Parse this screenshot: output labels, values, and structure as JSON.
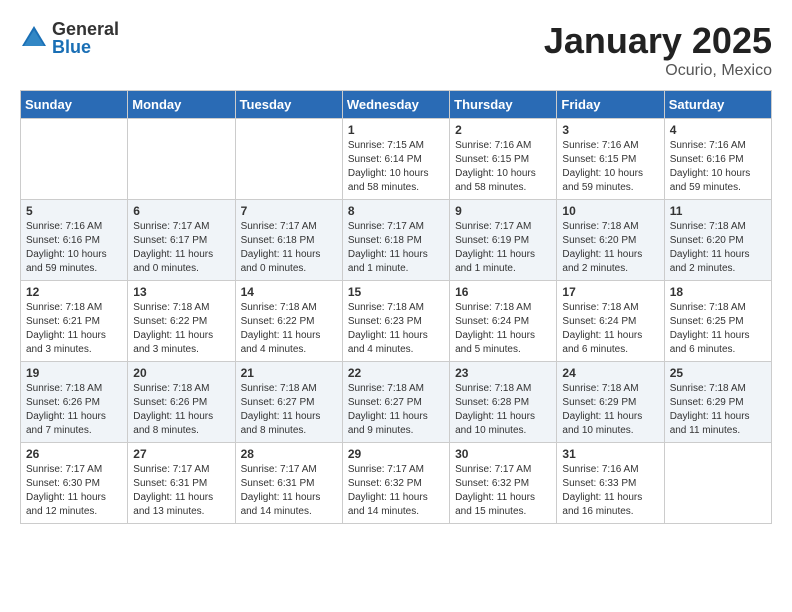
{
  "logo": {
    "general": "General",
    "blue": "Blue"
  },
  "title": "January 2025",
  "location": "Ocurio, Mexico",
  "weekdays": [
    "Sunday",
    "Monday",
    "Tuesday",
    "Wednesday",
    "Thursday",
    "Friday",
    "Saturday"
  ],
  "weeks": [
    [
      {
        "day": "",
        "sunrise": "",
        "sunset": "",
        "daylight": ""
      },
      {
        "day": "",
        "sunrise": "",
        "sunset": "",
        "daylight": ""
      },
      {
        "day": "",
        "sunrise": "",
        "sunset": "",
        "daylight": ""
      },
      {
        "day": "1",
        "sunrise": "Sunrise: 7:15 AM",
        "sunset": "Sunset: 6:14 PM",
        "daylight": "Daylight: 10 hours and 58 minutes."
      },
      {
        "day": "2",
        "sunrise": "Sunrise: 7:16 AM",
        "sunset": "Sunset: 6:15 PM",
        "daylight": "Daylight: 10 hours and 58 minutes."
      },
      {
        "day": "3",
        "sunrise": "Sunrise: 7:16 AM",
        "sunset": "Sunset: 6:15 PM",
        "daylight": "Daylight: 10 hours and 59 minutes."
      },
      {
        "day": "4",
        "sunrise": "Sunrise: 7:16 AM",
        "sunset": "Sunset: 6:16 PM",
        "daylight": "Daylight: 10 hours and 59 minutes."
      }
    ],
    [
      {
        "day": "5",
        "sunrise": "Sunrise: 7:16 AM",
        "sunset": "Sunset: 6:16 PM",
        "daylight": "Daylight: 10 hours and 59 minutes."
      },
      {
        "day": "6",
        "sunrise": "Sunrise: 7:17 AM",
        "sunset": "Sunset: 6:17 PM",
        "daylight": "Daylight: 11 hours and 0 minutes."
      },
      {
        "day": "7",
        "sunrise": "Sunrise: 7:17 AM",
        "sunset": "Sunset: 6:18 PM",
        "daylight": "Daylight: 11 hours and 0 minutes."
      },
      {
        "day": "8",
        "sunrise": "Sunrise: 7:17 AM",
        "sunset": "Sunset: 6:18 PM",
        "daylight": "Daylight: 11 hours and 1 minute."
      },
      {
        "day": "9",
        "sunrise": "Sunrise: 7:17 AM",
        "sunset": "Sunset: 6:19 PM",
        "daylight": "Daylight: 11 hours and 1 minute."
      },
      {
        "day": "10",
        "sunrise": "Sunrise: 7:18 AM",
        "sunset": "Sunset: 6:20 PM",
        "daylight": "Daylight: 11 hours and 2 minutes."
      },
      {
        "day": "11",
        "sunrise": "Sunrise: 7:18 AM",
        "sunset": "Sunset: 6:20 PM",
        "daylight": "Daylight: 11 hours and 2 minutes."
      }
    ],
    [
      {
        "day": "12",
        "sunrise": "Sunrise: 7:18 AM",
        "sunset": "Sunset: 6:21 PM",
        "daylight": "Daylight: 11 hours and 3 minutes."
      },
      {
        "day": "13",
        "sunrise": "Sunrise: 7:18 AM",
        "sunset": "Sunset: 6:22 PM",
        "daylight": "Daylight: 11 hours and 3 minutes."
      },
      {
        "day": "14",
        "sunrise": "Sunrise: 7:18 AM",
        "sunset": "Sunset: 6:22 PM",
        "daylight": "Daylight: 11 hours and 4 minutes."
      },
      {
        "day": "15",
        "sunrise": "Sunrise: 7:18 AM",
        "sunset": "Sunset: 6:23 PM",
        "daylight": "Daylight: 11 hours and 4 minutes."
      },
      {
        "day": "16",
        "sunrise": "Sunrise: 7:18 AM",
        "sunset": "Sunset: 6:24 PM",
        "daylight": "Daylight: 11 hours and 5 minutes."
      },
      {
        "day": "17",
        "sunrise": "Sunrise: 7:18 AM",
        "sunset": "Sunset: 6:24 PM",
        "daylight": "Daylight: 11 hours and 6 minutes."
      },
      {
        "day": "18",
        "sunrise": "Sunrise: 7:18 AM",
        "sunset": "Sunset: 6:25 PM",
        "daylight": "Daylight: 11 hours and 6 minutes."
      }
    ],
    [
      {
        "day": "19",
        "sunrise": "Sunrise: 7:18 AM",
        "sunset": "Sunset: 6:26 PM",
        "daylight": "Daylight: 11 hours and 7 minutes."
      },
      {
        "day": "20",
        "sunrise": "Sunrise: 7:18 AM",
        "sunset": "Sunset: 6:26 PM",
        "daylight": "Daylight: 11 hours and 8 minutes."
      },
      {
        "day": "21",
        "sunrise": "Sunrise: 7:18 AM",
        "sunset": "Sunset: 6:27 PM",
        "daylight": "Daylight: 11 hours and 8 minutes."
      },
      {
        "day": "22",
        "sunrise": "Sunrise: 7:18 AM",
        "sunset": "Sunset: 6:27 PM",
        "daylight": "Daylight: 11 hours and 9 minutes."
      },
      {
        "day": "23",
        "sunrise": "Sunrise: 7:18 AM",
        "sunset": "Sunset: 6:28 PM",
        "daylight": "Daylight: 11 hours and 10 minutes."
      },
      {
        "day": "24",
        "sunrise": "Sunrise: 7:18 AM",
        "sunset": "Sunset: 6:29 PM",
        "daylight": "Daylight: 11 hours and 10 minutes."
      },
      {
        "day": "25",
        "sunrise": "Sunrise: 7:18 AM",
        "sunset": "Sunset: 6:29 PM",
        "daylight": "Daylight: 11 hours and 11 minutes."
      }
    ],
    [
      {
        "day": "26",
        "sunrise": "Sunrise: 7:17 AM",
        "sunset": "Sunset: 6:30 PM",
        "daylight": "Daylight: 11 hours and 12 minutes."
      },
      {
        "day": "27",
        "sunrise": "Sunrise: 7:17 AM",
        "sunset": "Sunset: 6:31 PM",
        "daylight": "Daylight: 11 hours and 13 minutes."
      },
      {
        "day": "28",
        "sunrise": "Sunrise: 7:17 AM",
        "sunset": "Sunset: 6:31 PM",
        "daylight": "Daylight: 11 hours and 14 minutes."
      },
      {
        "day": "29",
        "sunrise": "Sunrise: 7:17 AM",
        "sunset": "Sunset: 6:32 PM",
        "daylight": "Daylight: 11 hours and 14 minutes."
      },
      {
        "day": "30",
        "sunrise": "Sunrise: 7:17 AM",
        "sunset": "Sunset: 6:32 PM",
        "daylight": "Daylight: 11 hours and 15 minutes."
      },
      {
        "day": "31",
        "sunrise": "Sunrise: 7:16 AM",
        "sunset": "Sunset: 6:33 PM",
        "daylight": "Daylight: 11 hours and 16 minutes."
      },
      {
        "day": "",
        "sunrise": "",
        "sunset": "",
        "daylight": ""
      }
    ]
  ]
}
